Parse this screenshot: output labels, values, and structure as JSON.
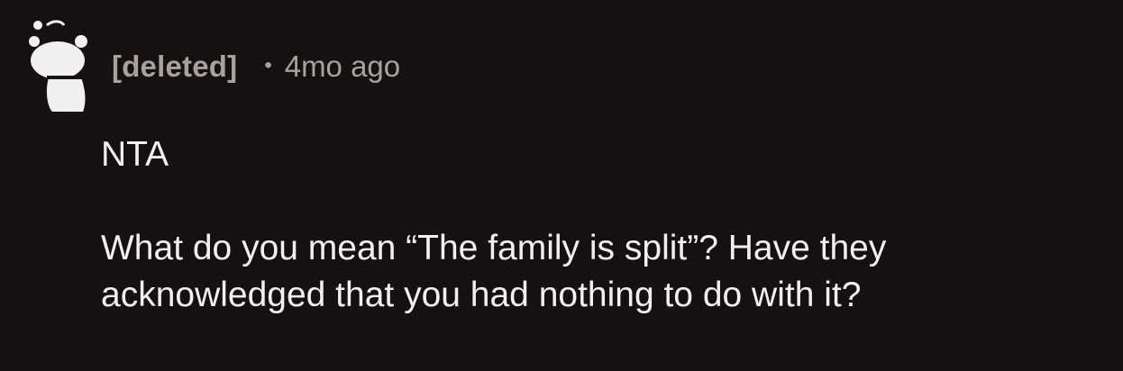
{
  "comment": {
    "author": "[deleted]",
    "separator": "•",
    "timestamp": "4mo ago",
    "avatar_icon": "snoo-avatar-icon",
    "paragraphs": [
      "NTA",
      "What do you mean “The family is split”? Have they acknowledged that you had nothing to do with it?"
    ]
  }
}
